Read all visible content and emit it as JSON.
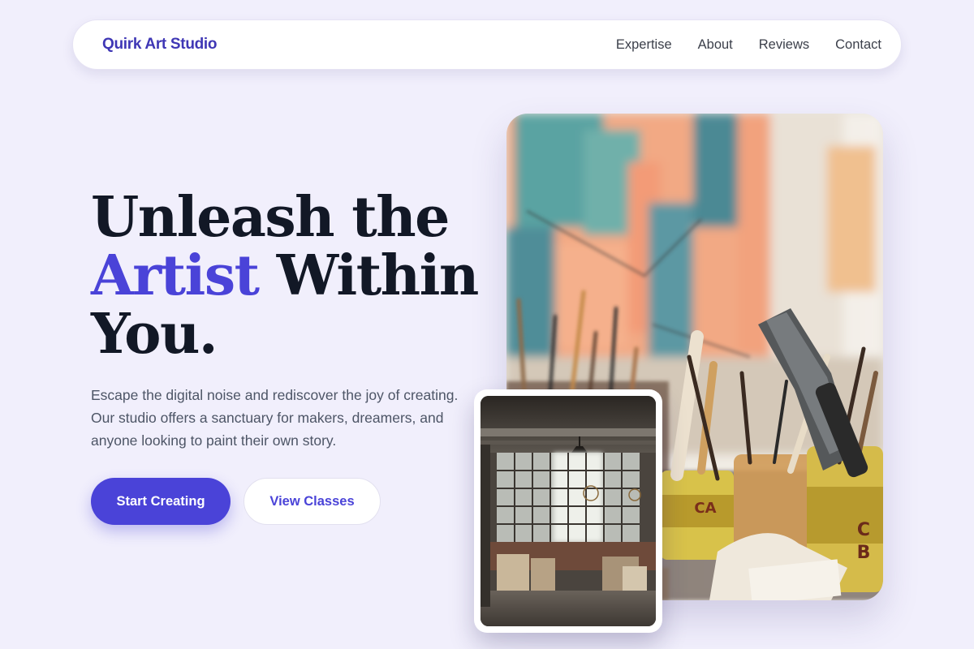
{
  "brand": {
    "name": "Quirk Art Studio"
  },
  "nav": {
    "links": [
      "Expertise",
      "About",
      "Reviews",
      "Contact"
    ]
  },
  "hero": {
    "headline": {
      "line1": "Unleash the",
      "accent": "Artist",
      "line2_rest": "Within",
      "line3": "You."
    },
    "subtitle": "Escape the digital noise and rediscover the joy of creating. Our studio offers a sanctuary for makers, dreamers, and anyone looking to paint their own story.",
    "primary_cta": "Start Creating",
    "secondary_cta": "View Classes"
  },
  "images": {
    "main": {
      "icon": "art-studio-brushes-image"
    },
    "secondary": {
      "icon": "warehouse-studio-image"
    }
  },
  "colors": {
    "accent": "#4a43d8",
    "brand": "#3f37b5",
    "background": "#f1effc",
    "headline": "#121826"
  }
}
